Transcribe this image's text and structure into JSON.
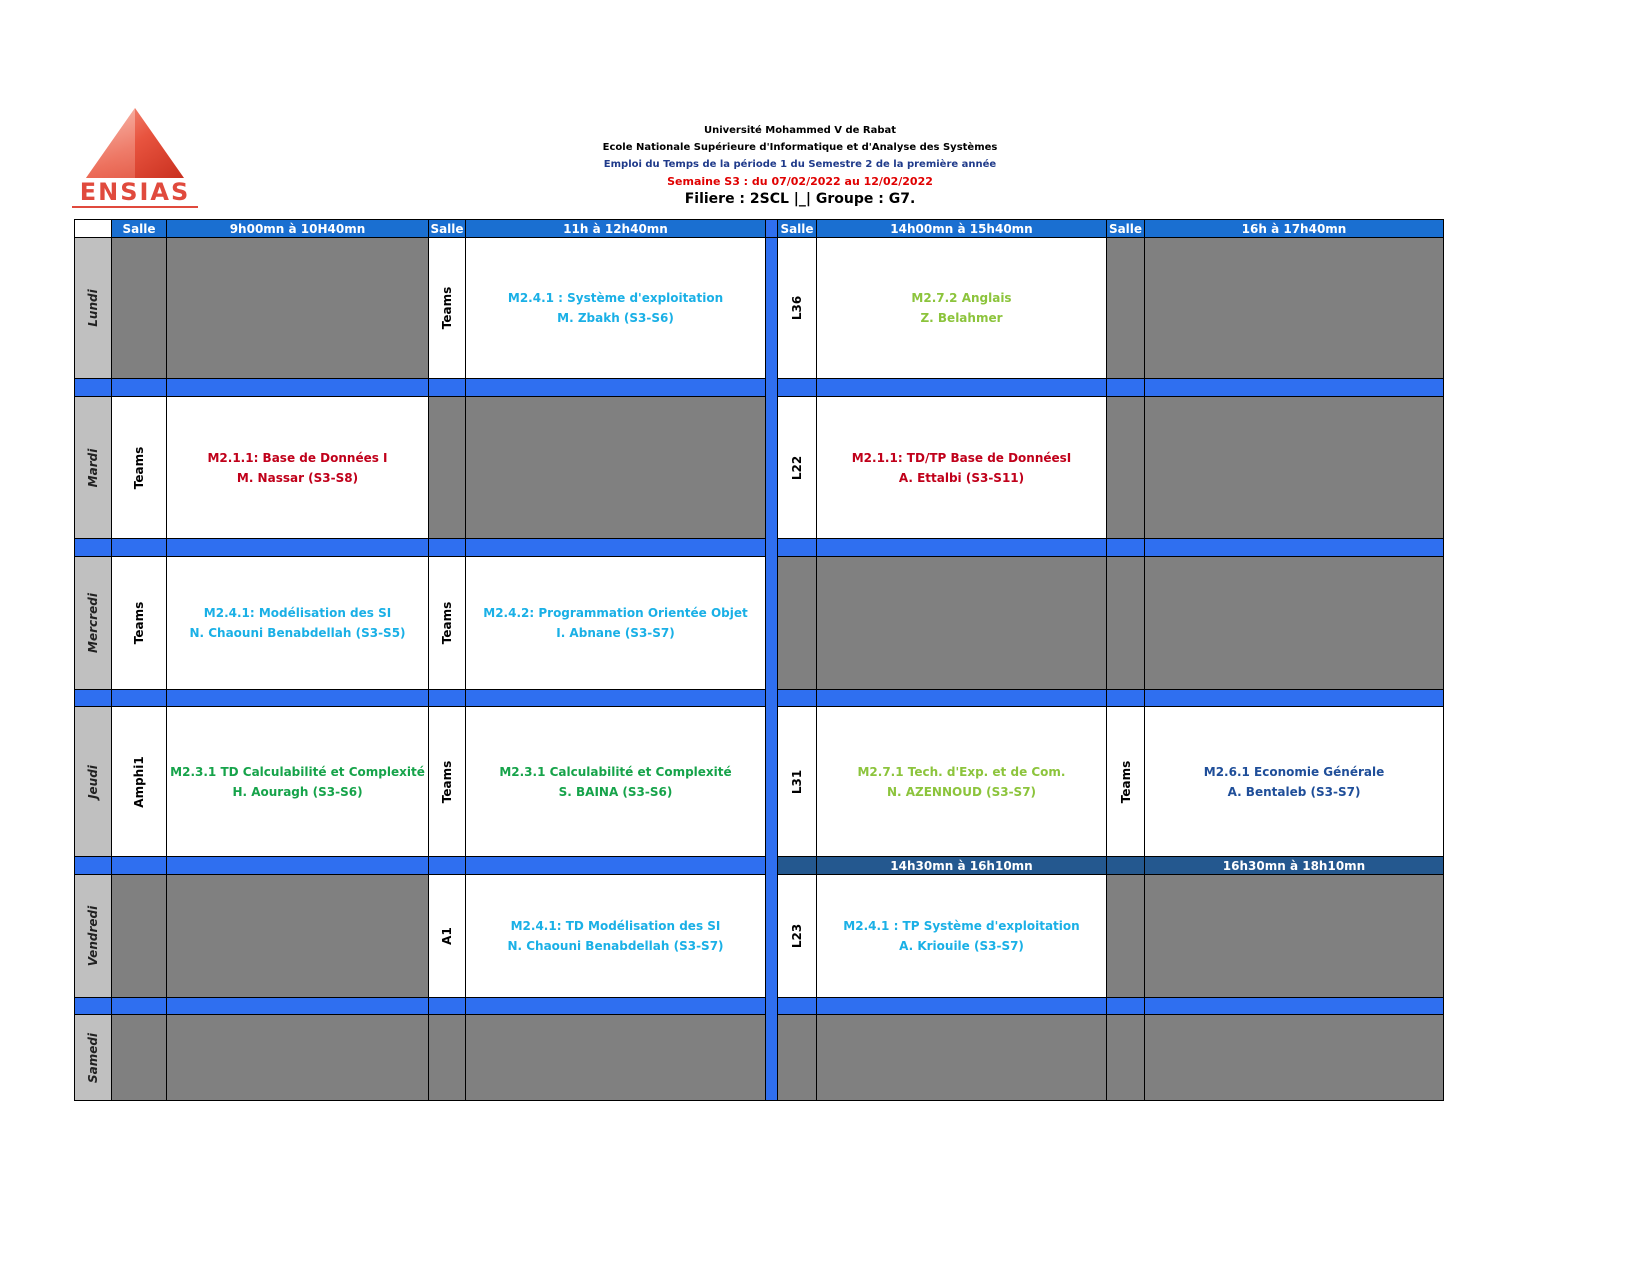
{
  "logo": {
    "text": "ENSIAS",
    "color": "#e04a3d"
  },
  "header": {
    "university": "Université Mohammed V de Rabat",
    "school": "Ecole Nationale Supérieure d'Informatique et d'Analyse des Systèmes",
    "schedule": "Emploi du Temps de la période 1 du Semestre 2 de la première année",
    "week": "Semaine S3 : du 07/02/2022 au 12/02/2022",
    "filiere": "Filiere : 2SCL |_| Groupe : G7."
  },
  "columns": {
    "salle": "Salle",
    "slot1": "9h00mn à 10H40mn",
    "slot2": "11h à 12h40mn",
    "slot3": "14h00mn à 15h40mn",
    "slot4": "16h à 17h40mn",
    "slot3_friday": "14h30mn à 16h10mn",
    "slot4_friday": "16h30mn à 18h10mn"
  },
  "days": {
    "lundi": {
      "label": "Lundi",
      "s2_room": "Teams",
      "s2_line1": "M2.4.1 : Système d'exploitation",
      "s2_line2": "M. Zbakh (S3-S6)",
      "s3_room": "L36",
      "s3_line1": "M2.7.2 Anglais",
      "s3_line2": "Z. Belahmer"
    },
    "mardi": {
      "label": "Mardi",
      "s1_room": "Teams",
      "s1_line1": "M2.1.1: Base de Données I",
      "s1_line2": "M. Nassar (S3-S8)",
      "s3_room": "L22",
      "s3_line1": "M2.1.1: TD/TP Base de DonnéesI",
      "s3_line2": "A. Ettalbi (S3-S11)"
    },
    "mercredi": {
      "label": "Mercredi",
      "s1_room": "Teams",
      "s1_line1": "M2.4.1: Modélisation des SI",
      "s1_line2": "N. Chaouni Benabdellah (S3-S5)",
      "s2_room": "Teams",
      "s2_line1": "M2.4.2: Programmation Orientée Objet",
      "s2_line2": "I. Abnane (S3-S7)"
    },
    "jeudi": {
      "label": "Jeudi",
      "s1_room": "Amphi1",
      "s1_line1": "M2.3.1 TD Calculabilité et Complexité",
      "s1_line2": "H. Aouragh (S3-S6)",
      "s2_room": "Teams",
      "s2_line1": "M2.3.1 Calculabilité et Complexité",
      "s2_line2": "S. BAINA (S3-S6)",
      "s3_room": "L31",
      "s3_line1": "M2.7.1 Tech. d'Exp. et de Com.",
      "s3_line2": "N. AZENNOUD (S3-S7)",
      "s4_room": "Teams",
      "s4_line1": "M2.6.1 Economie Générale",
      "s4_line2": "A. Bentaleb (S3-S7)"
    },
    "vendredi": {
      "label": "Vendredi",
      "s2_room": "A1",
      "s2_line1": "M2.4.1: TD Modélisation des SI",
      "s2_line2": "N. Chaouni Benabdellah (S3-S7)",
      "s3_room": "L23",
      "s3_line1": "M2.4.1 : TP Système d'exploitation",
      "s3_line2": "A. Kriouile (S3-S7)"
    },
    "samedi": {
      "label": "Samedi"
    }
  },
  "colors": {
    "header_blue": "#1a6fd1",
    "separator_blue": "#2f6ff0",
    "empty_gray": "#808080",
    "day_gray": "#c0c0c0",
    "cyan": "#1ab0e6",
    "red": "#c0001a",
    "green": "#16a34a",
    "lime": "#8cc43c",
    "navy": "#1f4e99"
  }
}
